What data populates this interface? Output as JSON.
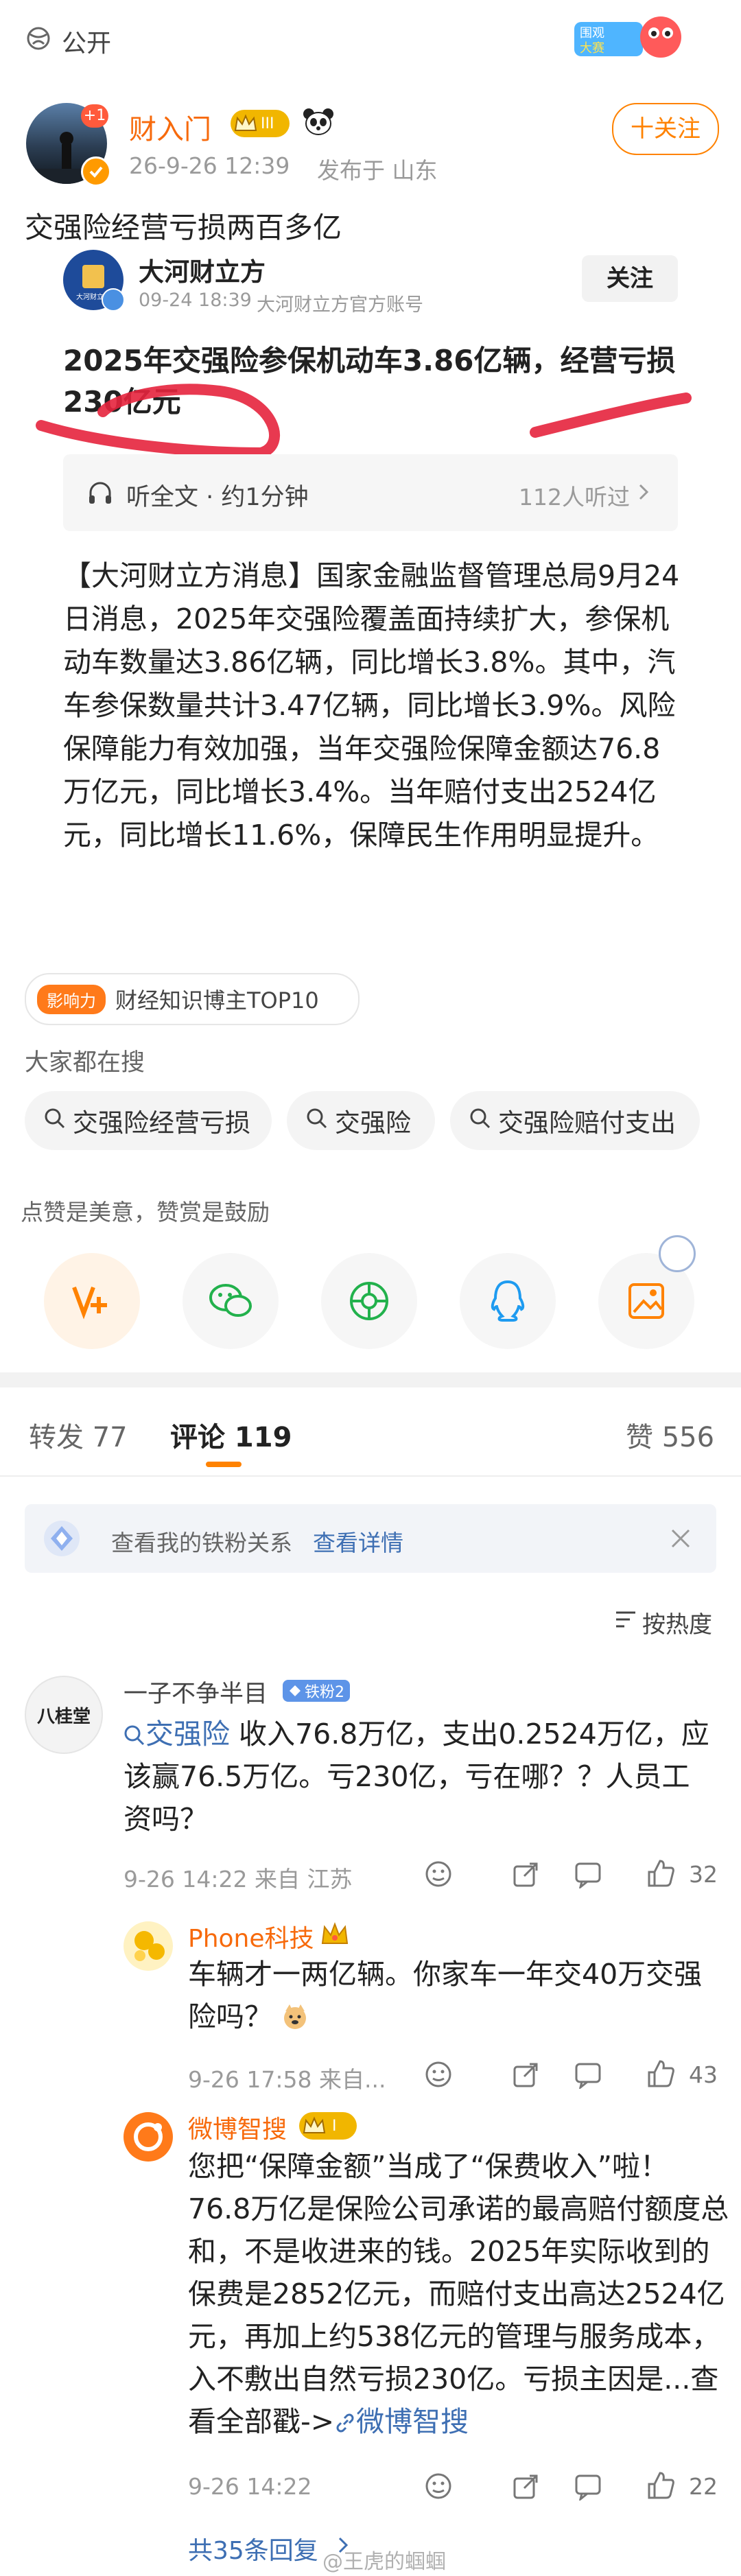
{
  "status_bar": {
    "privacy": "公开"
  },
  "post": {
    "author": "财入门",
    "level_badge": "III",
    "badge_count": "+1",
    "time": "26-9-26 12:39",
    "location": "发布于 山东",
    "follow_label": "十关注",
    "text": "交强险经营亏损两百多亿"
  },
  "repost": {
    "author": "大河财立方",
    "time": "09-24 18:39",
    "source": "大河财立方官方账号",
    "follow_label": "关注",
    "headline": "2025年交强险参保机动车3.86亿辆，经营亏损230亿元",
    "listen_label": "听全文 · 约1分钟",
    "listen_count": "112人听过",
    "body": "【大河财立方消息】国家金融监督管理总局9月24日消息，2025年交强险覆盖面持续扩大，参保机动车数量达3.86亿辆，同比增长3.8%。其中，汽车参保数量共计3.47亿辆，同比增长3.9%。风险保障能力有效加强，当年交强险保障金额达76.8万亿元，同比增长3.4%。当年赔付支出2524亿元，同比增长11.6%，保障民生作用明显提升。"
  },
  "influence": {
    "badge": "影响力",
    "text": "财经知识博主TOP10"
  },
  "search": {
    "title": "大家都在搜",
    "chips": [
      "交强险经营亏损",
      "交强险",
      "交强险赔付支出"
    ]
  },
  "reward": {
    "hint": "点赞是美意，赞赏是鼓励"
  },
  "tabs": {
    "repost": "转发 77",
    "comments": "评论 119",
    "likes": "赞 556"
  },
  "fans_banner": {
    "text": "查看我的铁粉关系",
    "link": "查看详情"
  },
  "sort": {
    "label": "按热度"
  },
  "comments": [
    {
      "avatar_text": "八桂堂",
      "author": "一子不争半目",
      "fan_badge": "铁粉2",
      "topic": "交强险",
      "text": " 收入76.8万亿，支出0.2524万亿，应该赢76.5万亿。亏230亿，亏在哪？？人员工资吗？",
      "time": "9-26 14:22 来自 江苏",
      "likes": "32"
    }
  ],
  "replies": [
    {
      "author": "Phone科技",
      "text": "车辆才一两亿辆。你家车一年交40万交强险吗？",
      "time": "9-26 17:58 来自...",
      "likes": "43"
    },
    {
      "author": "微博智搜",
      "level_badge": "I",
      "text": "您把“保障金额”当成了“保费收入”啦！76.8万亿是保险公司承诺的最高赔付额度总和，不是收进来的钱。2025年实际收到的保费是2852亿元，而赔付支出高达2524亿元，再加上约538亿元的管理与服务成本，入不敷出自然亏损230亿。亏损主因是...",
      "more": "查看全部戳->",
      "more_link": "微博智搜",
      "time": "9-26 14:22",
      "likes": "22"
    }
  ],
  "replies_more": "共35条回复",
  "watermark": "@王虎的蝈蝈"
}
